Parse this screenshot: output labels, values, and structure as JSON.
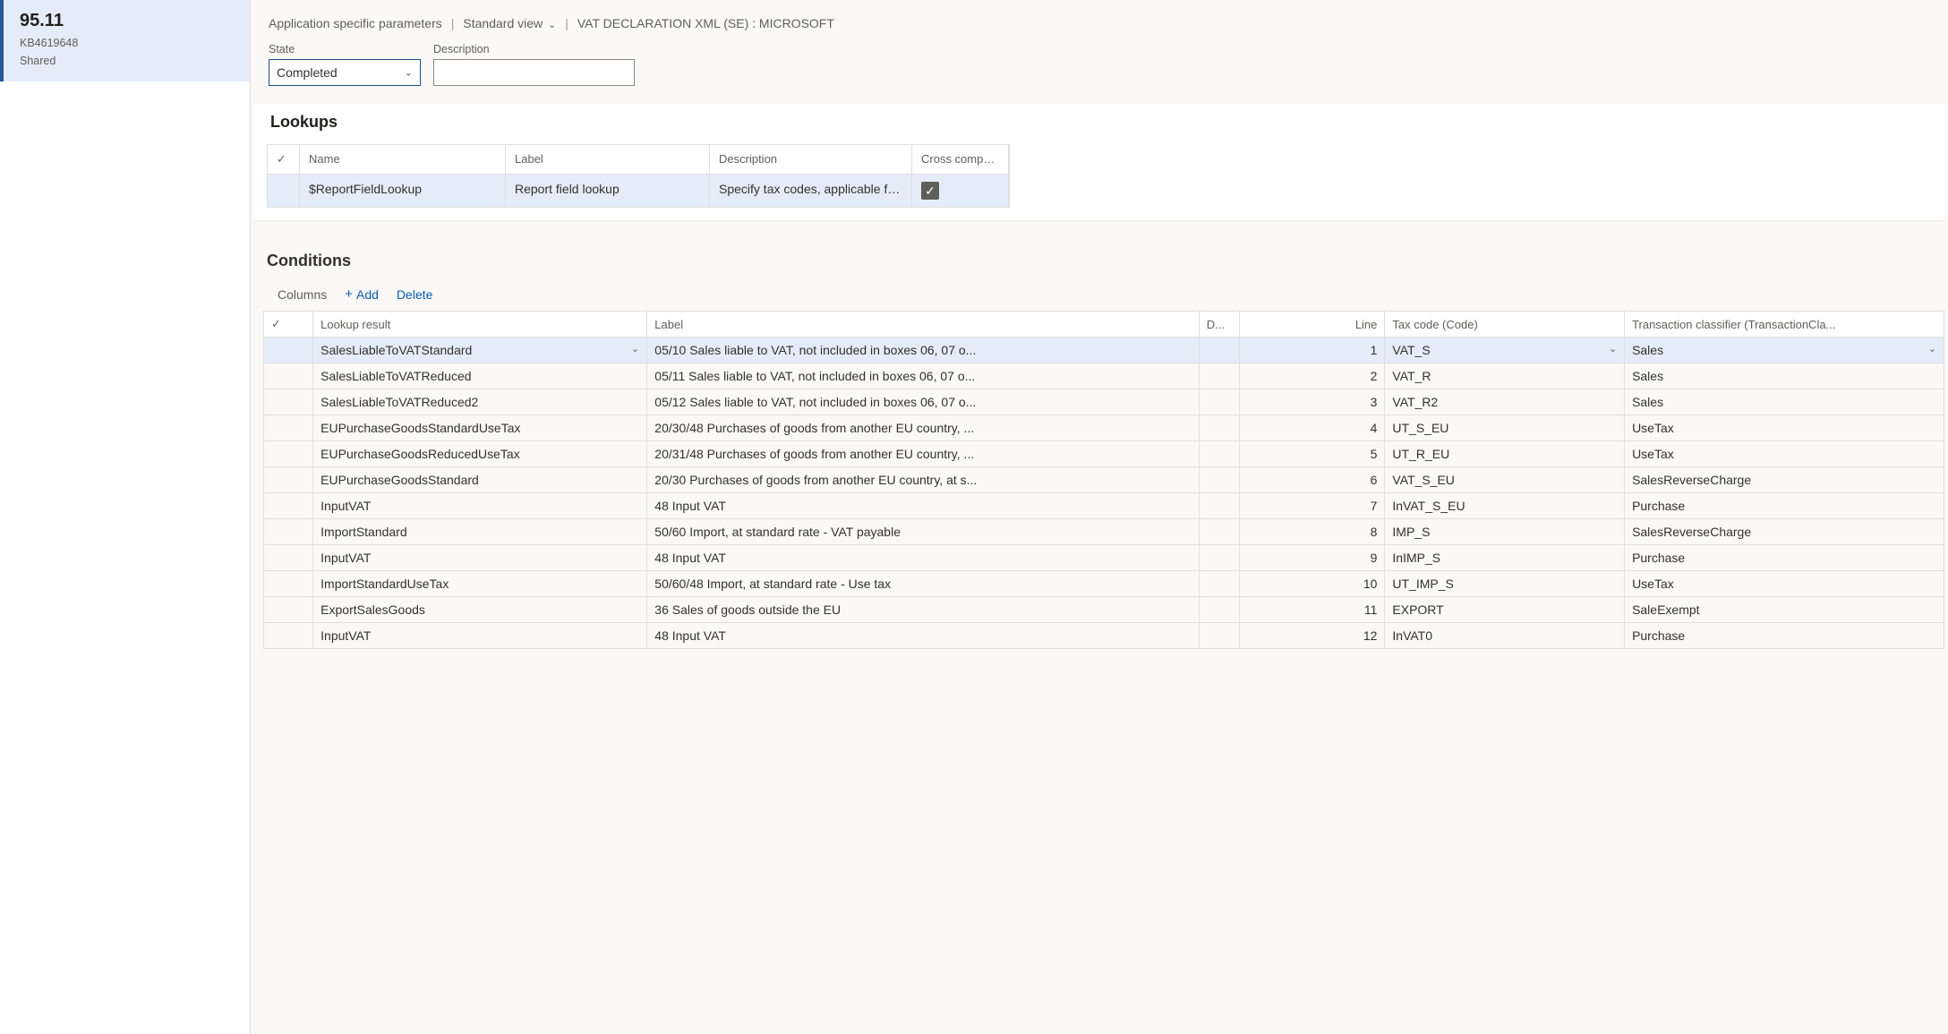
{
  "sidebar": {
    "version": "95.11",
    "kb": "KB4619648",
    "shared": "Shared"
  },
  "breadcrumb": {
    "app_params": "Application specific parameters",
    "view": "Standard view",
    "title": "VAT DECLARATION XML (SE) : MICROSOFT"
  },
  "fields": {
    "state_label": "State",
    "state_value": "Completed",
    "desc_label": "Description",
    "desc_value": ""
  },
  "lookups": {
    "heading": "Lookups",
    "headers": {
      "name": "Name",
      "label": "Label",
      "description": "Description",
      "cross": "Cross company"
    },
    "row": {
      "name": "$ReportFieldLookup",
      "label": "Report field lookup",
      "description": "Specify tax codes, applicable for...",
      "cross": true
    }
  },
  "conditions": {
    "heading": "Conditions",
    "toolbar": {
      "columns": "Columns",
      "add": "Add",
      "delete": "Delete"
    },
    "headers": {
      "lookup_result": "Lookup result",
      "label": "Label",
      "d": "D...",
      "line": "Line",
      "tax_code": "Tax code (Code)",
      "classifier": "Transaction classifier (TransactionCla..."
    },
    "rows": [
      {
        "result": "SalesLiableToVATStandard",
        "label": "05/10 Sales liable to VAT, not included in boxes 06, 07 o...",
        "line": 1,
        "code": "VAT_S",
        "class": "Sales",
        "selected": true
      },
      {
        "result": "SalesLiableToVATReduced",
        "label": "05/11 Sales liable to VAT, not included in boxes 06, 07 o...",
        "line": 2,
        "code": "VAT_R",
        "class": "Sales"
      },
      {
        "result": "SalesLiableToVATReduced2",
        "label": "05/12 Sales liable to VAT, not included in boxes 06, 07 o...",
        "line": 3,
        "code": "VAT_R2",
        "class": "Sales"
      },
      {
        "result": "EUPurchaseGoodsStandardUseTax",
        "label": "20/30/48 Purchases of goods from another EU country, ...",
        "line": 4,
        "code": "UT_S_EU",
        "class": "UseTax"
      },
      {
        "result": "EUPurchaseGoodsReducedUseTax",
        "label": "20/31/48 Purchases of goods from another EU country, ...",
        "line": 5,
        "code": "UT_R_EU",
        "class": "UseTax"
      },
      {
        "result": "EUPurchaseGoodsStandard",
        "label": "20/30 Purchases of goods from another EU country, at s...",
        "line": 6,
        "code": "VAT_S_EU",
        "class": "SalesReverseCharge"
      },
      {
        "result": "InputVAT",
        "label": "48 Input VAT",
        "line": 7,
        "code": "InVAT_S_EU",
        "class": "Purchase"
      },
      {
        "result": "ImportStandard",
        "label": "50/60 Import, at standard rate - VAT payable",
        "line": 8,
        "code": "IMP_S",
        "class": "SalesReverseCharge"
      },
      {
        "result": "InputVAT",
        "label": "48 Input VAT",
        "line": 9,
        "code": "InIMP_S",
        "class": "Purchase"
      },
      {
        "result": "ImportStandardUseTax",
        "label": "50/60/48 Import, at standard rate - Use tax",
        "line": 10,
        "code": "UT_IMP_S",
        "class": "UseTax"
      },
      {
        "result": "ExportSalesGoods",
        "label": "36 Sales of goods outside the EU",
        "line": 11,
        "code": "EXPORT",
        "class": "SaleExempt"
      },
      {
        "result": "InputVAT",
        "label": "48 Input VAT",
        "line": 12,
        "code": "InVAT0",
        "class": "Purchase"
      }
    ]
  }
}
